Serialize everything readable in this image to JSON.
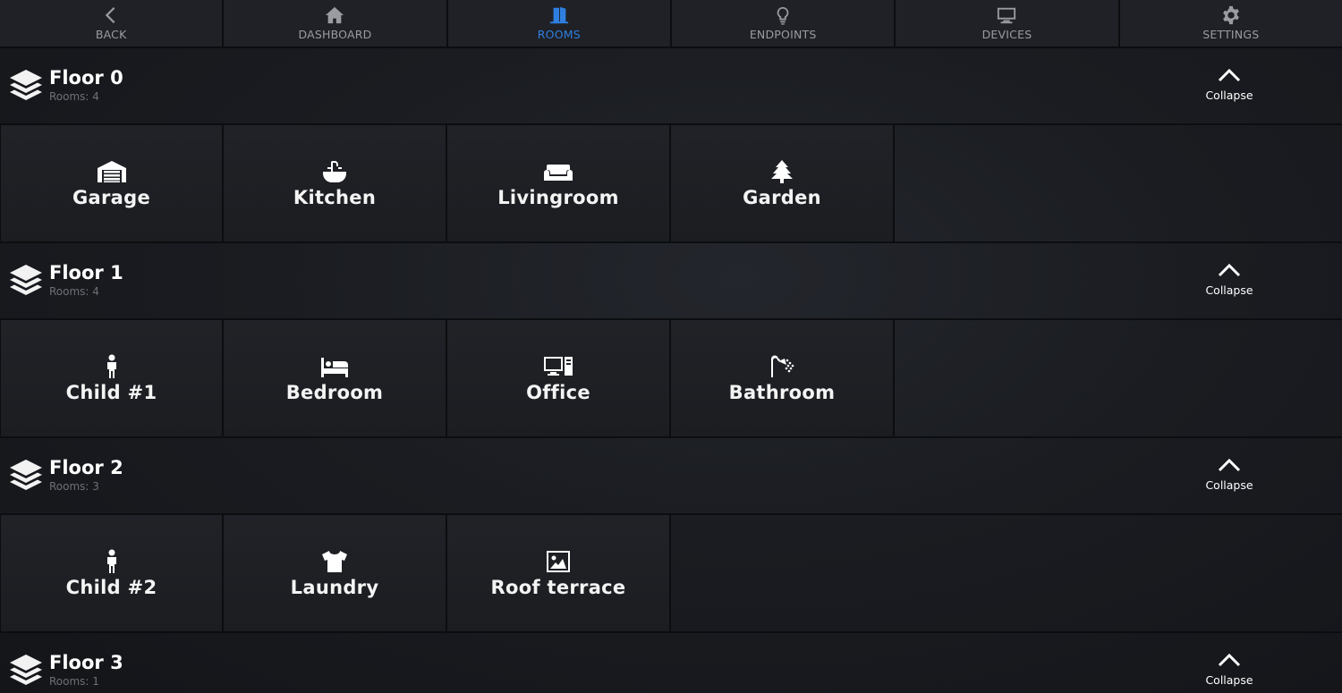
{
  "nav": [
    {
      "id": "back",
      "label": "BACK",
      "icon": "chevron-left-icon",
      "active": false
    },
    {
      "id": "dashboard",
      "label": "DASHBOARD",
      "icon": "home-icon",
      "active": false
    },
    {
      "id": "rooms",
      "label": "ROOMS",
      "icon": "door-icon",
      "active": true
    },
    {
      "id": "endpoints",
      "label": "ENDPOINTS",
      "icon": "lightbulb-icon",
      "active": false
    },
    {
      "id": "devices",
      "label": "DEVICES",
      "icon": "monitor-icon",
      "active": false
    },
    {
      "id": "settings",
      "label": "SETTINGS",
      "icon": "gear-icon",
      "active": false
    }
  ],
  "colors": {
    "active": "#2f7fe0",
    "inactive": "#9a9ca2",
    "background": "#17191e"
  },
  "floors": [
    {
      "title": "Floor 0",
      "subtitle": "Rooms: 4",
      "collapse_label": "Collapse",
      "rooms": [
        {
          "name": "Garage",
          "icon": "garage-icon"
        },
        {
          "name": "Kitchen",
          "icon": "sink-icon"
        },
        {
          "name": "Livingroom",
          "icon": "sofa-icon"
        },
        {
          "name": "Garden",
          "icon": "tree-icon"
        }
      ]
    },
    {
      "title": "Floor 1",
      "subtitle": "Rooms: 4",
      "collapse_label": "Collapse",
      "rooms": [
        {
          "name": "Child #1",
          "icon": "child-icon"
        },
        {
          "name": "Bedroom",
          "icon": "bed-icon"
        },
        {
          "name": "Office",
          "icon": "desktop-computer-icon"
        },
        {
          "name": "Bathroom",
          "icon": "shower-icon"
        }
      ]
    },
    {
      "title": "Floor 2",
      "subtitle": "Rooms: 3",
      "collapse_label": "Collapse",
      "rooms": [
        {
          "name": "Child #2",
          "icon": "child-icon"
        },
        {
          "name": "Laundry",
          "icon": "tshirt-icon"
        },
        {
          "name": "Roof terrace",
          "icon": "image-icon"
        }
      ]
    },
    {
      "title": "Floor 3",
      "subtitle": "Rooms: 1",
      "collapse_label": "Collapse",
      "rooms": []
    }
  ]
}
